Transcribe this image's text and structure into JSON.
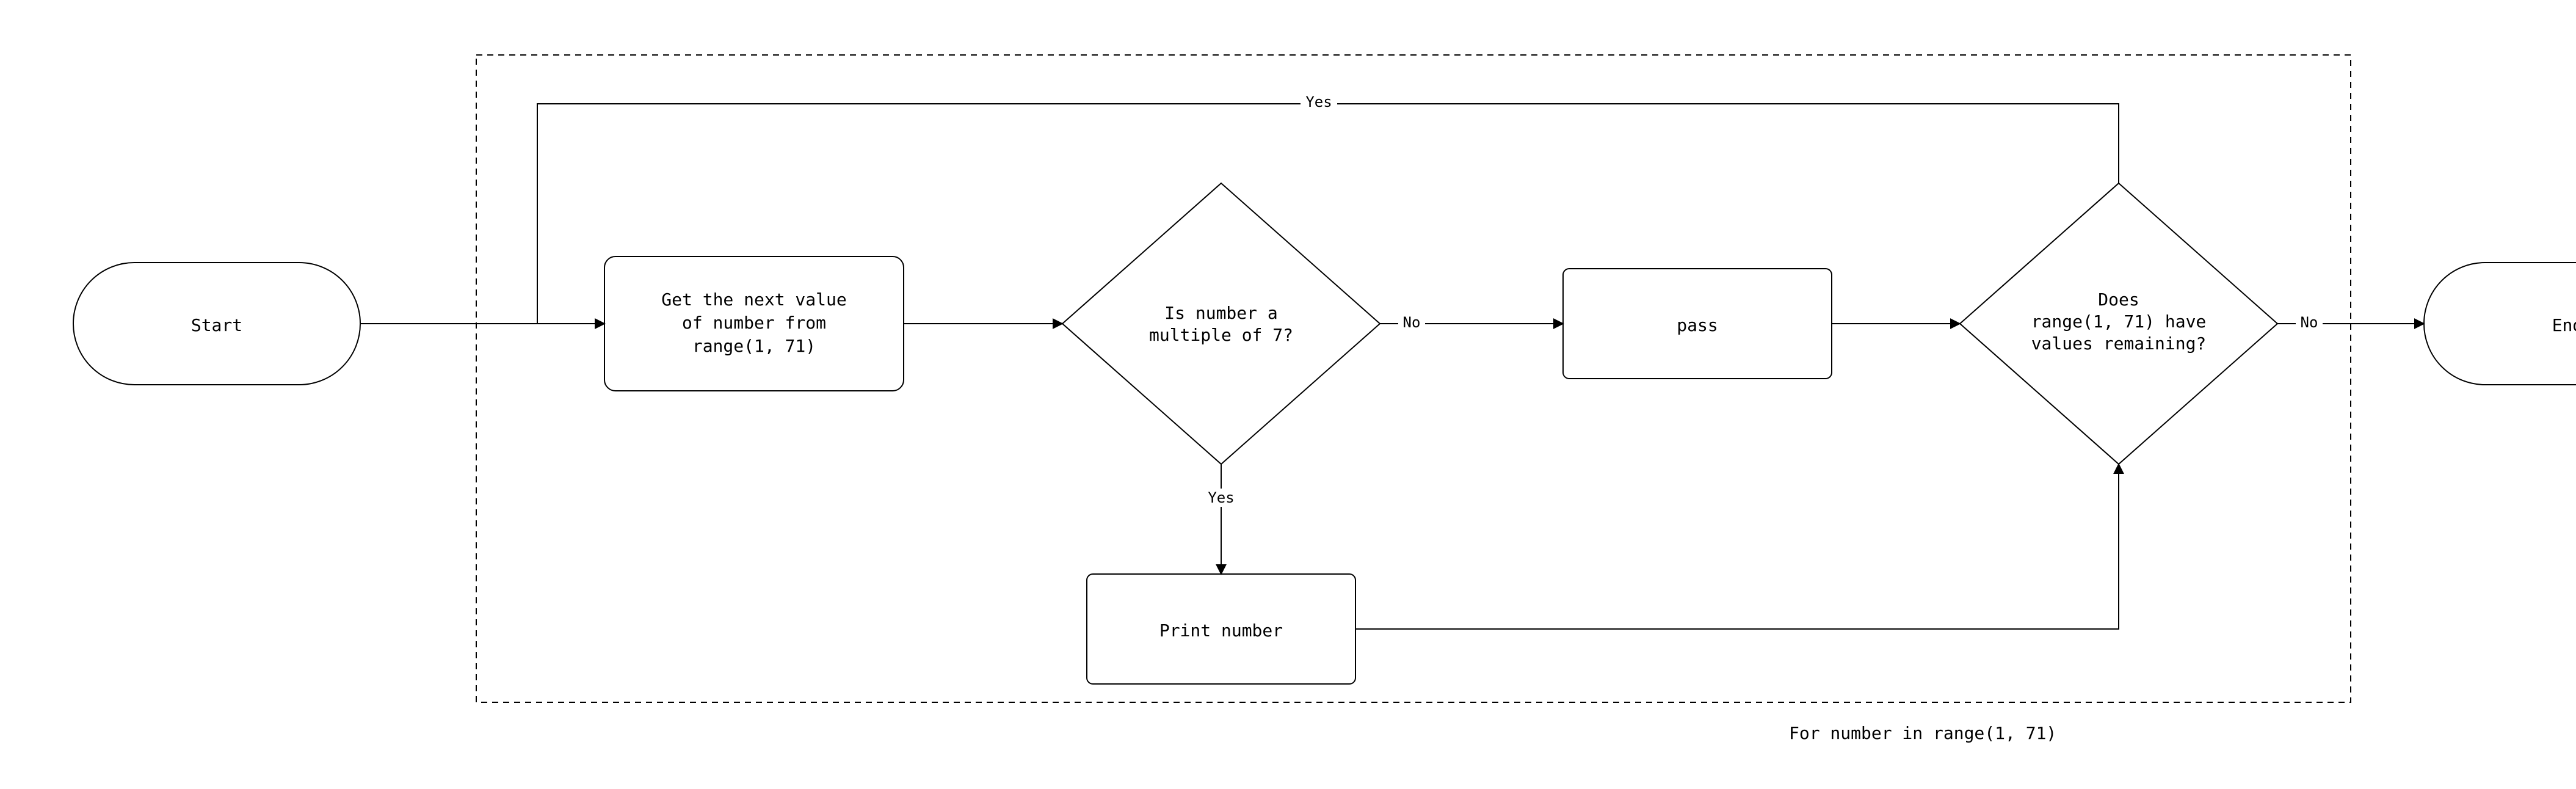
{
  "nodes": {
    "start": "Start",
    "get_next_1": "Get the next value",
    "get_next_2": "of number from",
    "get_next_3": "range(1, 71)",
    "decision_1a": "Is number a",
    "decision_1b": "multiple of 7?",
    "pass": "pass",
    "decision_2a": "Does",
    "decision_2b": "range(1, 71) have",
    "decision_2c": "values remaining?",
    "print": "Print number",
    "end": "End"
  },
  "edges": {
    "yes": "Yes",
    "no": "No"
  },
  "caption": "For number in range(1, 71)"
}
